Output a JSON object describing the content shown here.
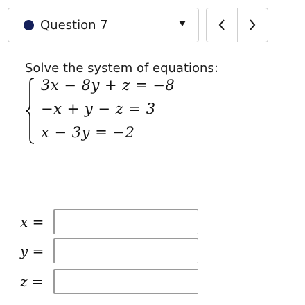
{
  "question_nav": {
    "selected_label": "Question 7",
    "status_color": "#14205a",
    "prev_icon": "chevron-left-icon",
    "next_icon": "chevron-right-icon",
    "dropdown_icon": "caret-down-icon"
  },
  "problem": {
    "prompt": "Solve the system of equations:",
    "equations": [
      "3x − 8y + z = −8",
      "−x + y − z = 3",
      "x − 3y = −2"
    ]
  },
  "answers": [
    {
      "label": "x =",
      "value": ""
    },
    {
      "label": "y =",
      "value": ""
    },
    {
      "label": "z =",
      "value": ""
    }
  ]
}
